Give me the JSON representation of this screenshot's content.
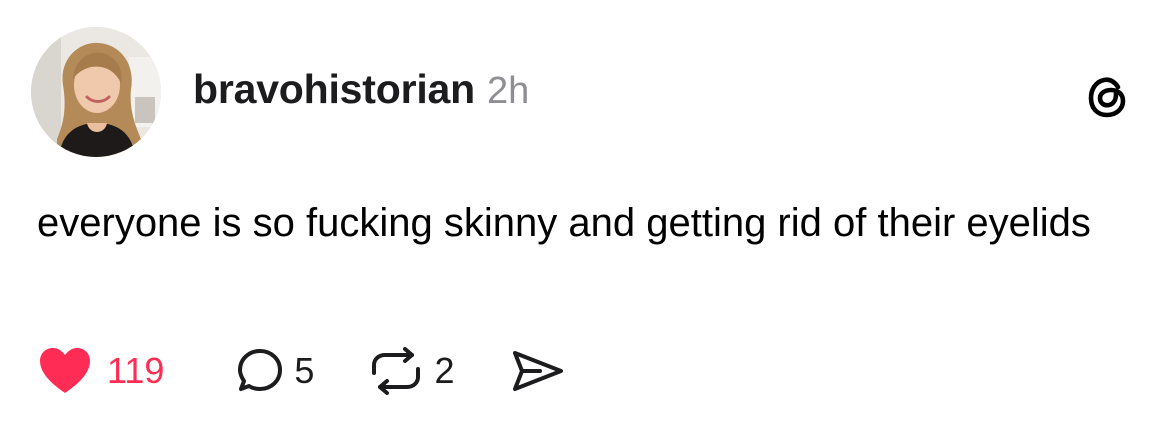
{
  "post": {
    "username": "bravohistorian",
    "timestamp": "2h",
    "text": "everyone is so fucking skinny and getting rid of their eyelids",
    "avatar_icon": "profile-photo",
    "brand_icon": "threads-logo-icon"
  },
  "actions": {
    "likes": "119",
    "replies": "5",
    "reposts": "2",
    "like_icon": "heart-filled-icon",
    "reply_icon": "speech-bubble-icon",
    "repost_icon": "repost-arrows-icon",
    "share_icon": "send-icon"
  },
  "colors": {
    "like": "#ff2d55",
    "username": "#1c1c1e",
    "timestamp": "#8e8e93",
    "text": "#000000",
    "background": "#ffffff"
  }
}
